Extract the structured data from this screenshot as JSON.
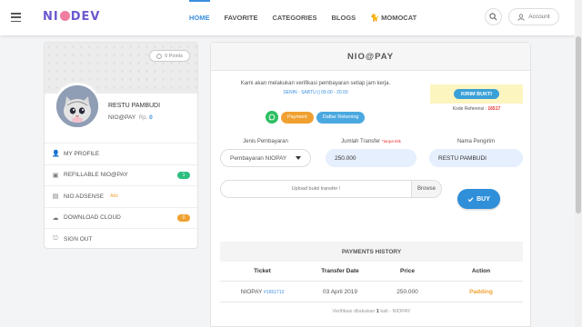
{
  "app": {
    "logo": {
      "pre": "NI",
      "post": "DEV"
    }
  },
  "nav": {
    "items": [
      {
        "label": "HOME",
        "active": true
      },
      {
        "label": "FAVORITE",
        "active": false
      },
      {
        "label": "CATEGORIES",
        "active": false
      },
      {
        "label": "BLOGS",
        "active": false
      },
      {
        "label": "MOMOCAT",
        "active": false
      }
    ],
    "account_label": "Account"
  },
  "profile": {
    "points": "0 Points",
    "name": "RESTU PAMBUDI",
    "wallet_label": "NIO@PAY",
    "currency": "Rp.",
    "balance": "0",
    "menu": [
      {
        "label": "MY PROFILE",
        "icon": "user-icon"
      },
      {
        "label": "REFILLABLE NIO@PAY",
        "icon": "refill-icon",
        "badge": "1",
        "badge_color": "#2dbf80"
      },
      {
        "label": "NIO ADSENSE",
        "icon": "adsense-icon",
        "sup": "Ads"
      },
      {
        "label": "DOWNLOAD CLOUD",
        "icon": "cloud-icon",
        "badge": "0",
        "badge_color": "#f0a030"
      },
      {
        "label": "SIGN OUT",
        "icon": "sign-out-icon"
      }
    ]
  },
  "pay": {
    "title": "NIO@PAY",
    "info": "Kami akan melakukan verifikasi pembayaran setiap jam kerja.",
    "hours": "SENIN - SABTU || 09.00 - 20.00",
    "chips": {
      "payment": "Payment",
      "daftar": "Daftar Rekening"
    },
    "kirim_button": "KIRIM BUKTI",
    "kode_label": "Kode Referensi :",
    "kode_value": "16517",
    "labels": {
      "jenis": "Jenis Pembayaran",
      "jumlah": "Jumlah Transfer",
      "jumlah_hint": "*tanpa titik",
      "pengirim": "Nama Pengirim"
    },
    "values": {
      "jenis": "Pembayaran NIOPAY",
      "jumlah": "250.000",
      "pengirim": "RESTU PAMBUDI"
    },
    "upload_placeholder": "Upload bukti transfer !",
    "browse_label": "Browse",
    "buy_label": "BUY"
  },
  "history": {
    "title": "PAYMENTS HISTORY",
    "columns": [
      "Ticket",
      "Transfer Date",
      "Price",
      "Action"
    ],
    "rows": [
      {
        "ticket": "NIOPAY",
        "ticket_num": "#1651713",
        "date": "03 April 2019",
        "price": "250.000",
        "action": "Padding"
      }
    ],
    "note_pre": "Verifikasi dilakukan",
    "note_count": "1",
    "note_post": "kali - NIOPAY"
  },
  "colors": {
    "accent": "#3b8fe0",
    "whatsapp": "#2dbf62",
    "warning": "#f0a030",
    "highlight": "#fdf5bf"
  }
}
